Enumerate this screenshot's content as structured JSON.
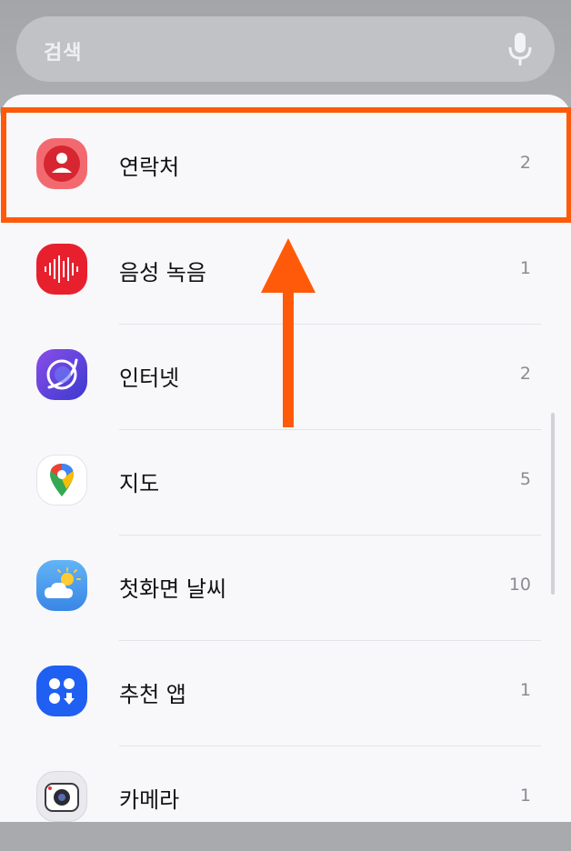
{
  "search": {
    "placeholder": "검색"
  },
  "results": [
    {
      "label": "연락처",
      "count": "2",
      "icon": "contacts-icon"
    },
    {
      "label": "음성 녹음",
      "count": "1",
      "icon": "voice-recorder-icon"
    },
    {
      "label": "인터넷",
      "count": "2",
      "icon": "internet-browser-icon"
    },
    {
      "label": "지도",
      "count": "5",
      "icon": "maps-icon"
    },
    {
      "label": "첫화면 날씨",
      "count": "10",
      "icon": "weather-icon"
    },
    {
      "label": "추천 앱",
      "count": "1",
      "icon": "recommended-apps-icon"
    },
    {
      "label": "카메라",
      "count": "1",
      "icon": "camera-icon"
    }
  ],
  "colors": {
    "highlight": "#ff5a0a",
    "contacts": "#e8353d",
    "voice": "#e8202e",
    "internet": "#5b3fd9",
    "weather": "#4a9ef0",
    "recommended": "#1f5ff2"
  }
}
